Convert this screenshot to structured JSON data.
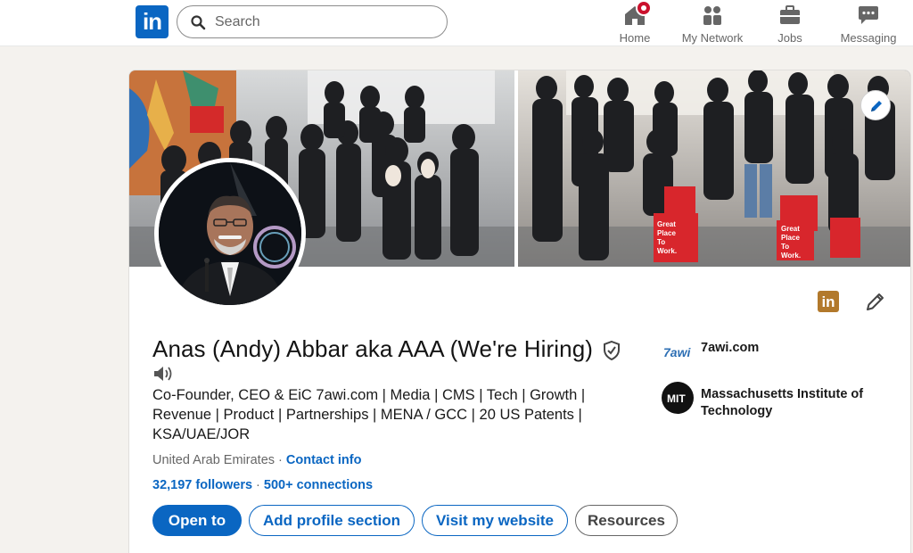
{
  "nav": {
    "logo": "in",
    "search_placeholder": "Search",
    "items": [
      {
        "label": "Home",
        "icon": "home-icon",
        "notification": true
      },
      {
        "label": "My Network",
        "icon": "network-icon"
      },
      {
        "label": "Jobs",
        "icon": "briefcase-icon"
      },
      {
        "label": "Messaging",
        "icon": "messaging-icon"
      }
    ]
  },
  "profile": {
    "name": "Anas (Andy) Abbar aka AAA (We're Hiring)",
    "headline": "Co-Founder, CEO & EiC 7awi.com | Media | CMS | Tech | Growth | Revenue | Product | Partnerships | MENA / GCC | 20 US Patents | KSA/UAE/JOR",
    "location": "United Arab Emirates",
    "separator": " · ",
    "contact_info": "Contact info",
    "followers": "32,197 followers",
    "connections": "500+ connections",
    "badge_logo": "in",
    "buttons": {
      "open_to": "Open to",
      "add_section": "Add profile section",
      "visit_website": "Visit my website",
      "resources": "Resources"
    },
    "right_panel": {
      "company": "7awi.com",
      "company_logo_text": "7awi",
      "school": "Massachusetts Institute of Technology",
      "school_logo_text": "MIT"
    }
  },
  "colors": {
    "brand_blue": "#0a66c2",
    "notification_red": "#cb112d",
    "premium_gold": "#b2792b",
    "page_bg": "#f4f2ee"
  }
}
